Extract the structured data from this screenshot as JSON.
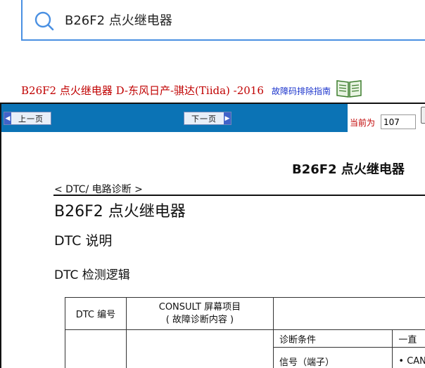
{
  "search": {
    "query": "B26F2 点火继电器"
  },
  "doc_header": {
    "title": "B26F2 点火继电器 D-东风日产-骐达(Tiida) -2016",
    "guide_link": "故障码排除指南"
  },
  "nav": {
    "prev_label": "上一页",
    "next_label": "下一页",
    "page_label": "当前为",
    "page_value": "107"
  },
  "page": {
    "heading": "B26F2 点火继电器",
    "breadcrumb": "< DTC/ 电路诊断 >",
    "title": "B26F2 点火继电器",
    "section_1": "DTC 说明",
    "section_2": "DTC 检测逻辑"
  },
  "table": {
    "header": {
      "col1": "DTC 编号",
      "col2_line1": "CONSULT 屏幕项目",
      "col2_line2": "( 故障诊断内容 )"
    },
    "rows": [
      {
        "label": "诊断条件",
        "value": "一直"
      },
      {
        "label": "信号（端子）",
        "value": "• CAN"
      }
    ]
  }
}
